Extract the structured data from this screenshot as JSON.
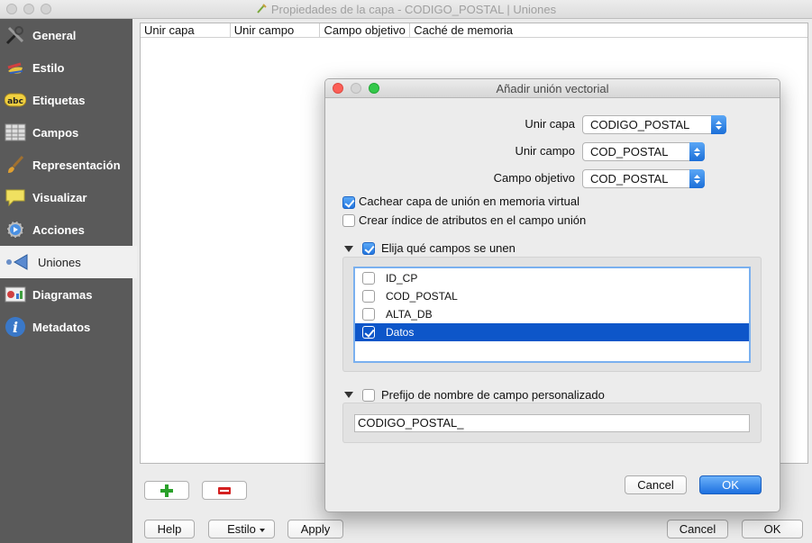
{
  "window": {
    "title": "Propiedades de la capa - CODIGO_POSTAL | Uniones"
  },
  "sidebar": {
    "items": [
      {
        "label": "General",
        "icon": "tools-icon"
      },
      {
        "label": "Estilo",
        "icon": "brush-icon"
      },
      {
        "label": "Etiquetas",
        "icon": "abc-label-icon"
      },
      {
        "label": "Campos",
        "icon": "table-icon"
      },
      {
        "label": "Representación",
        "icon": "paintbrush-icon"
      },
      {
        "label": "Visualizar",
        "icon": "speech-bubble-icon"
      },
      {
        "label": "Acciones",
        "icon": "gear-play-icon"
      },
      {
        "label": "Uniones",
        "icon": "join-icon"
      },
      {
        "label": "Diagramas",
        "icon": "diagram-icon"
      },
      {
        "label": "Metadatos",
        "icon": "info-icon"
      }
    ]
  },
  "joins_table": {
    "headers": [
      "Unir capa",
      "Unir campo",
      "Campo objetivo",
      "Caché de memoria"
    ]
  },
  "bottom": {
    "help": "Help",
    "style": "Estilo",
    "apply": "Apply",
    "cancel": "Cancel",
    "ok": "OK"
  },
  "dialog": {
    "title": "Añadir unión vectorial",
    "join_layer_label": "Unir capa",
    "join_layer_value": "CODIGO_POSTAL",
    "join_field_label": "Unir campo",
    "join_field_value": "COD_POSTAL",
    "target_field_label": "Campo objetivo",
    "target_field_value": "COD_POSTAL",
    "cache_label": "Cachear capa de unión en memoria virtual",
    "cache_checked": true,
    "index_label": "Crear índice de atributos en el campo unión",
    "index_checked": false,
    "choose_fields_label": "Elija qué campos se unen",
    "choose_fields_checked": true,
    "fields": [
      {
        "name": "ID_CP",
        "checked": false
      },
      {
        "name": "COD_POSTAL",
        "checked": false
      },
      {
        "name": "ALTA_DB",
        "checked": false
      },
      {
        "name": "Datos",
        "checked": true
      }
    ],
    "prefix_label": "Prefijo de nombre de campo personalizado",
    "prefix_checked": false,
    "prefix_value": "CODIGO_POSTAL_",
    "cancel": "Cancel",
    "ok": "OK"
  },
  "colors": {
    "sidebar_bg": "#5a5a5a",
    "accent": "#1c6fd8",
    "selection": "#0d56c9"
  }
}
